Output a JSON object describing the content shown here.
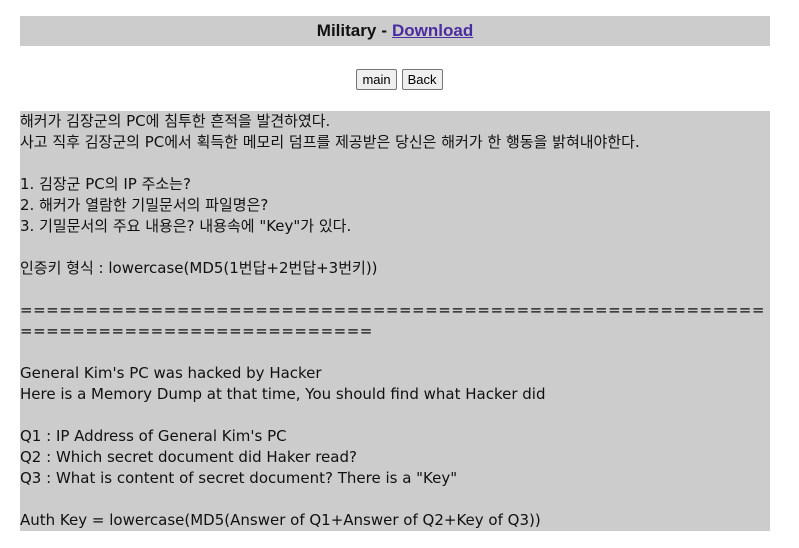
{
  "header": {
    "title": "Military",
    "separator": "-",
    "link_label": "Download"
  },
  "buttons": {
    "main_label": "main",
    "back_label": "Back"
  },
  "content": {
    "line_1": "해커가 김장군의 PC에 침투한 흔적을 발견하였다.",
    "line_2": "사고 직후 김장군의 PC에서 획득한 메모리 덤프를 제공받은 당신은 해커가 한 행동을 밝혀내야한다.",
    "q1_kr": "1. 김장군 PC의 IP 주소는?",
    "q2_kr": "2. 해커가 열람한 기밀문서의 파일명은?",
    "q3_kr": "3. 기밀문서의 주요 내용은? 내용속에 \"Key\"가 있다.",
    "auth_kr": "인증키 형식 : lowercase(MD5(1번답+2번답+3번키))",
    "divider": "====================================================================================",
    "line_en_1": "General Kim's PC was hacked by Hacker",
    "line_en_2": "Here is a Memory Dump at that time, You should find what Hacker did",
    "q1_en": "Q1 : IP Address of General Kim's PC",
    "q2_en": "Q2 : Which secret document did Haker read?",
    "q3_en": "Q3 : What is content of secret document? There is a \"Key\"",
    "auth_en": "Auth Key = lowercase(MD5(Answer of Q1+Answer of Q2+Key of Q3))"
  }
}
